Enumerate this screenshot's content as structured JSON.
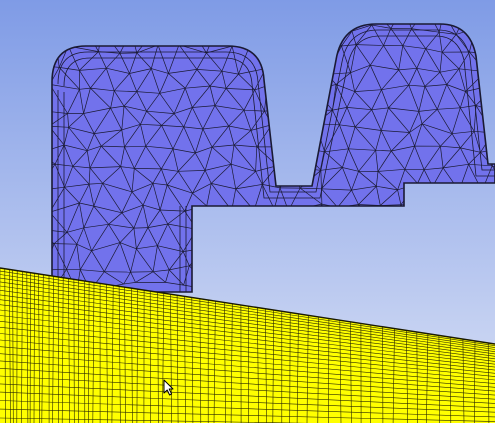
{
  "viewport": {
    "background_top": "#7f9be6",
    "background_bottom": "#d8e0f5"
  },
  "mesh_blue": {
    "fill": "#7272ec",
    "edge_color": "#1a1a33",
    "kind": "triangular surface mesh with boundary inflation layers"
  },
  "mesh_yellow": {
    "fill": "#ffff00",
    "edge_color": "#2a2a00",
    "kind": "structured quadrilateral mesh"
  },
  "cursor": {
    "icon": "arrow-pointer-icon"
  }
}
